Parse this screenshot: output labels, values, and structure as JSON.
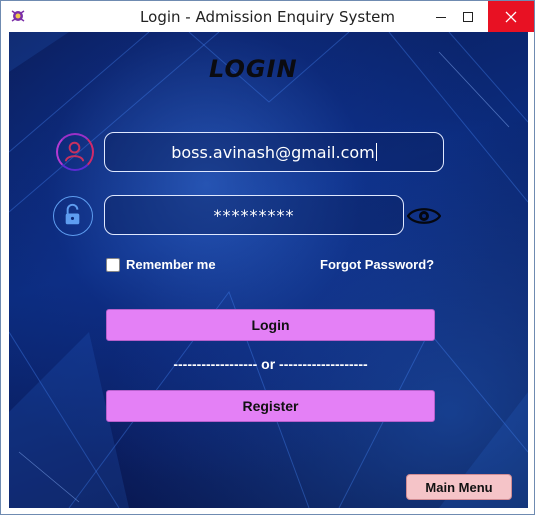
{
  "window": {
    "title": "Login - Admission Enquiry System"
  },
  "form": {
    "heading": "LOGIN",
    "email_value": "boss.avinash@gmail.com",
    "password_masked": "*********",
    "remember_label": "Remember me",
    "remember_checked": false,
    "forgot_label": "Forgot Password?",
    "login_label": "Login",
    "separator": "------------------ or -------------------",
    "register_label": "Register",
    "main_menu_label": "Main Menu"
  },
  "icons": {
    "app": "app-icon",
    "user": "user-icon",
    "lock": "lock-icon",
    "eye": "eye-icon"
  },
  "colors": {
    "background": "#0b2a7a",
    "button_pink": "#e480f6",
    "main_menu_button": "#f5c4c8",
    "close_button": "#e81123"
  }
}
